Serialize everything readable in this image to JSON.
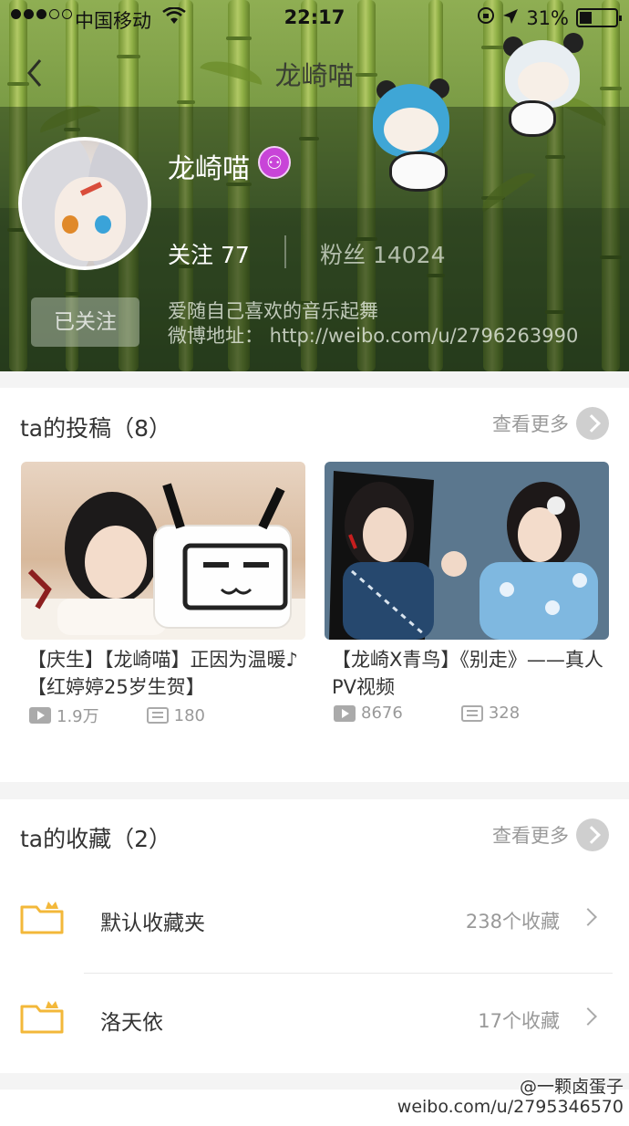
{
  "status_bar": {
    "carrier": "中国移动",
    "time": "22:17",
    "battery": "31%",
    "signal_dots": [
      true,
      true,
      true,
      false,
      false
    ]
  },
  "nav": {
    "title": "龙崎喵"
  },
  "profile": {
    "name": "龙崎喵",
    "follow_label": "关注",
    "follow_count": "77",
    "fans_label": "粉丝",
    "fans_count": "14024",
    "followed_button": "已关注",
    "bio_line1": "爱随自己喜欢的音乐起舞",
    "bio_line2": "微博地址：  http://weibo.com/u/2796263990",
    "badge_color": "#c844d8"
  },
  "submissions": {
    "title": "ta的投稿（8）",
    "more_label": "查看更多",
    "videos": [
      {
        "title": "【庆生】【龙崎喵】正因为温暖♪【红婷婷25岁生贺】",
        "plays": "1.9万",
        "comments": "180"
      },
      {
        "title": "【龙崎X青鸟】《别走》——真人PV视频",
        "plays": "8676",
        "comments": "328"
      }
    ]
  },
  "favorites": {
    "title": "ta的收藏（2）",
    "more_label": "查看更多",
    "folders": [
      {
        "name": "默认收藏夹",
        "count": "238个收藏"
      },
      {
        "name": "洛天依",
        "count": "17个收藏"
      }
    ],
    "icon_color": "#f3b83a"
  },
  "watermark": {
    "line1": "@一颗卤蛋子",
    "line2": "weibo.com/u/2795346570"
  }
}
